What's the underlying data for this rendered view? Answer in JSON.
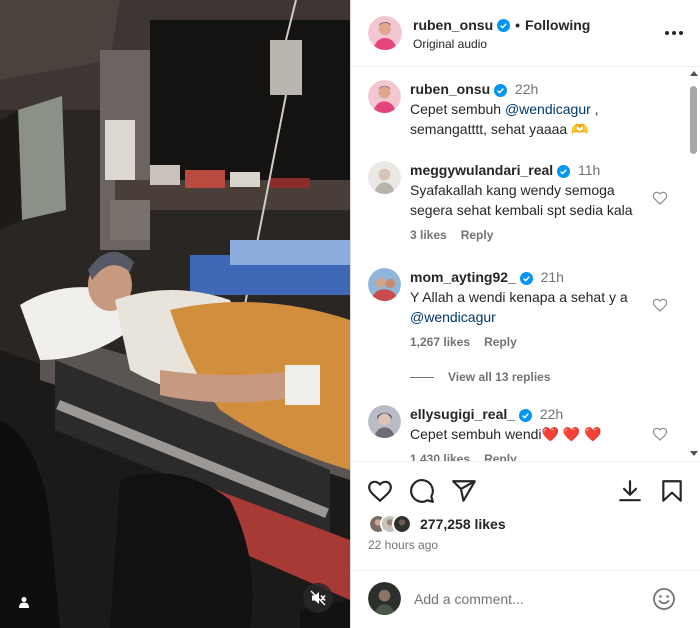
{
  "post": {
    "author": "ruben_onsu",
    "follow_separator": "•",
    "follow_state": "Following",
    "audio": "Original audio",
    "more_icon": "more-options-icon"
  },
  "comments": [
    {
      "username": "ruben_onsu",
      "time": "22h",
      "text_before": "Cepet sembuh ",
      "mention": "@wendicagur",
      "text_after": " , semangatttt, sehat yaaaa 🫶"
    },
    {
      "username": "meggywulandari_real",
      "time": "11h",
      "text": "Syafakallah kang wendy semoga segera sehat kembali spt sedia kala",
      "likes": "3 likes",
      "reply": "Reply"
    },
    {
      "username": "mom_ayting92_",
      "time": "21h",
      "text": "Y Allah a wendi kenapa a sehat y a",
      "mention": "@wendicagur",
      "likes": "1,267 likes",
      "reply": "Reply",
      "view_replies": "View all 13 replies"
    },
    {
      "username": "ellysugigi_real_",
      "time": "22h",
      "text": "Cepet sembuh wendi❤️ ❤️ ❤️",
      "likes": "1,430 likes",
      "reply": "Reply"
    }
  ],
  "actions": {
    "like_icon": "heart-icon",
    "comment_icon": "comment-icon",
    "share_icon": "share-icon",
    "save_icon": "bookmark-icon",
    "download_icon": "download-icon"
  },
  "likes_count": "277,258 likes",
  "posted_ago": "22 hours ago",
  "add_comment": {
    "placeholder": "Add a comment...",
    "emoji_icon": "emoji-icon"
  },
  "colors": {
    "verified": "#0095f6",
    "mention": "#00376b",
    "secondary_text": "#737373",
    "primary_text": "#262626"
  }
}
